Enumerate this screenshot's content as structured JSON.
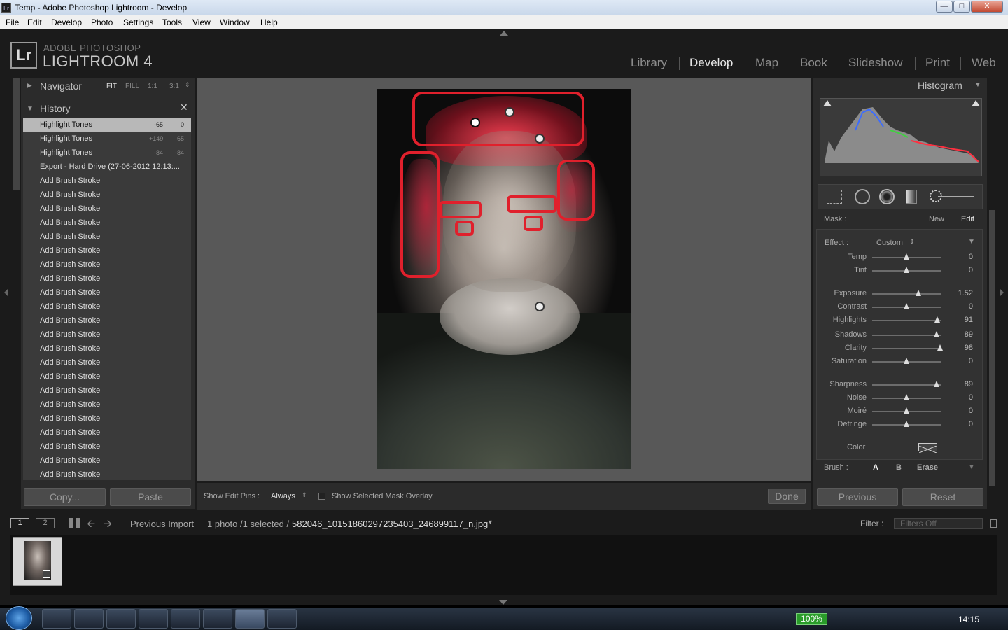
{
  "window": {
    "title": "Temp - Adobe Photoshop Lightroom - Develop"
  },
  "menu": [
    "File",
    "Edit",
    "Develop",
    "Photo",
    "Settings",
    "Tools",
    "View",
    "Window",
    "Help"
  ],
  "brand": {
    "logo": "Lr",
    "line1": "ADOBE PHOTOSHOP",
    "line2": "LIGHTROOM 4"
  },
  "modules": [
    "Library",
    "Develop",
    "Map",
    "Book",
    "Slideshow",
    "Print",
    "Web"
  ],
  "active_module": "Develop",
  "navigator": {
    "title": "Navigator",
    "zoom": [
      "FIT",
      "FILL",
      "1:1",
      "3:1"
    ]
  },
  "history": {
    "title": "History",
    "items": [
      {
        "label": "Highlight Tones",
        "v1": "-65",
        "v2": "0"
      },
      {
        "label": "Highlight Tones",
        "v1": "+149",
        "v2": "65"
      },
      {
        "label": "Highlight Tones",
        "v1": "-84",
        "v2": "-84"
      },
      {
        "label": "Export - Hard Drive (27-06-2012 12:13:...",
        "v1": "",
        "v2": ""
      },
      {
        "label": "Add Brush Stroke",
        "v1": "",
        "v2": ""
      },
      {
        "label": "Add Brush Stroke",
        "v1": "",
        "v2": ""
      },
      {
        "label": "Add Brush Stroke",
        "v1": "",
        "v2": ""
      },
      {
        "label": "Add Brush Stroke",
        "v1": "",
        "v2": ""
      },
      {
        "label": "Add Brush Stroke",
        "v1": "",
        "v2": ""
      },
      {
        "label": "Add Brush Stroke",
        "v1": "",
        "v2": ""
      },
      {
        "label": "Add Brush Stroke",
        "v1": "",
        "v2": ""
      },
      {
        "label": "Add Brush Stroke",
        "v1": "",
        "v2": ""
      },
      {
        "label": "Add Brush Stroke",
        "v1": "",
        "v2": ""
      },
      {
        "label": "Add Brush Stroke",
        "v1": "",
        "v2": ""
      },
      {
        "label": "Add Brush Stroke",
        "v1": "",
        "v2": ""
      },
      {
        "label": "Add Brush Stroke",
        "v1": "",
        "v2": ""
      },
      {
        "label": "Add Brush Stroke",
        "v1": "",
        "v2": ""
      },
      {
        "label": "Add Brush Stroke",
        "v1": "",
        "v2": ""
      },
      {
        "label": "Add Brush Stroke",
        "v1": "",
        "v2": ""
      },
      {
        "label": "Add Brush Stroke",
        "v1": "",
        "v2": ""
      },
      {
        "label": "Add Brush Stroke",
        "v1": "",
        "v2": ""
      },
      {
        "label": "Add Brush Stroke",
        "v1": "",
        "v2": ""
      },
      {
        "label": "Add Brush Stroke",
        "v1": "",
        "v2": ""
      },
      {
        "label": "Add Brush Stroke",
        "v1": "",
        "v2": ""
      },
      {
        "label": "Add Brush Stroke",
        "v1": "",
        "v2": ""
      },
      {
        "label": "Add Brush Stroke",
        "v1": "",
        "v2": ""
      }
    ]
  },
  "left_buttons": {
    "copy": "Copy...",
    "paste": "Paste"
  },
  "toolbar": {
    "show_pins_label": "Show Edit Pins :",
    "show_pins_value": "Always",
    "overlay_label": "Show Selected Mask Overlay",
    "done": "Done"
  },
  "histogram": {
    "title": "Histogram"
  },
  "mask": {
    "label": "Mask :",
    "new": "New",
    "edit": "Edit"
  },
  "effect": {
    "label": "Effect :",
    "value": "Custom"
  },
  "sliders": [
    {
      "name": "Temp",
      "value": "0",
      "pos": 0.5
    },
    {
      "name": "Tint",
      "value": "0",
      "pos": 0.5
    },
    {
      "name": "Exposure",
      "value": "1.52",
      "pos": 0.67
    },
    {
      "name": "Contrast",
      "value": "0",
      "pos": 0.5
    },
    {
      "name": "Highlights",
      "value": "91",
      "pos": 0.95
    },
    {
      "name": "Shadows",
      "value": "89",
      "pos": 0.94
    },
    {
      "name": "Clarity",
      "value": "98",
      "pos": 0.99
    },
    {
      "name": "Saturation",
      "value": "0",
      "pos": 0.5
    },
    {
      "name": "Sharpness",
      "value": "89",
      "pos": 0.94
    },
    {
      "name": "Noise",
      "value": "0",
      "pos": 0.5
    },
    {
      "name": "Moiré",
      "value": "0",
      "pos": 0.5
    },
    {
      "name": "Defringe",
      "value": "0",
      "pos": 0.5
    }
  ],
  "color_label": "Color",
  "brush": {
    "label": "Brush :",
    "a": "A",
    "b": "B",
    "erase": "Erase"
  },
  "right_buttons": {
    "previous": "Previous",
    "reset": "Reset"
  },
  "filmbar": {
    "page1": "1",
    "page2": "2",
    "source": "Previous Import",
    "info": "1 photo /1 selected /",
    "filename": "582046_10151860297235403_246899117_n.jpg",
    "filter_label": "Filter :",
    "filter_value": "Filters Off"
  },
  "taskbar": {
    "battery": "100%",
    "clock": "14:15"
  },
  "colors": {
    "annotation": "#e0202c",
    "panel": "#2b2b2b",
    "selected_row": "#b8b8b8"
  }
}
